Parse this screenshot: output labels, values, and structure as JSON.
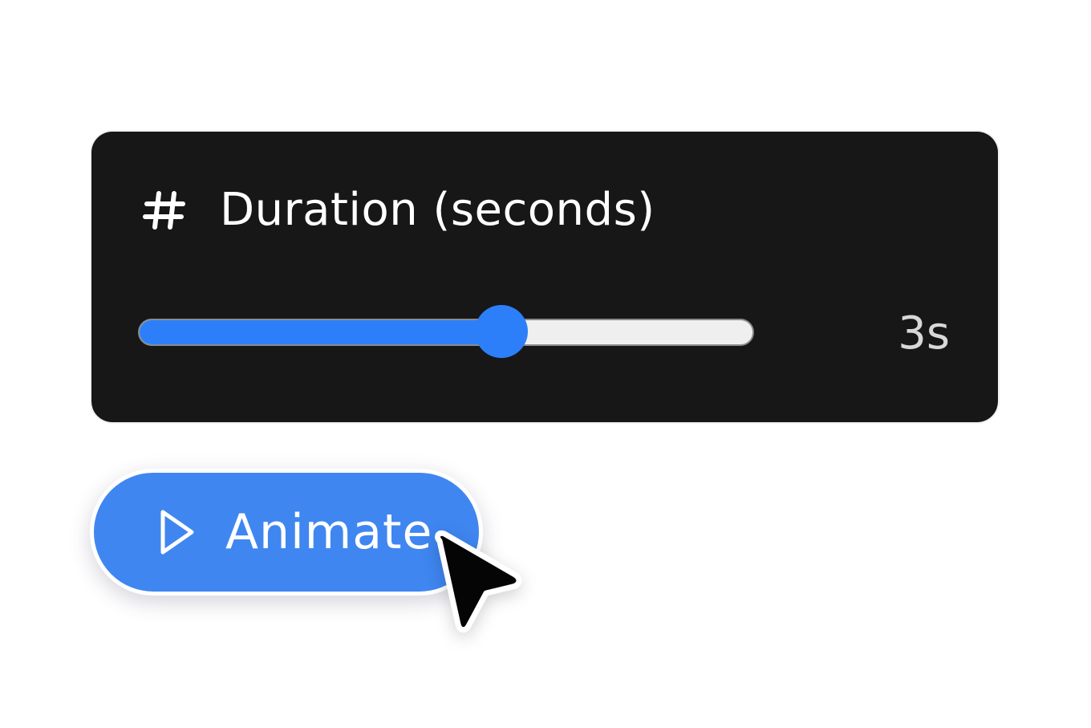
{
  "field": {
    "icon": "hash-icon",
    "label": "Duration (seconds)"
  },
  "slider": {
    "value_fraction": 0.59,
    "value_text": "3s"
  },
  "button": {
    "icon": "play-icon",
    "label": "Animate"
  },
  "cursor": {
    "icon": "mouse-pointer-icon"
  },
  "colors": {
    "panel_background": "#171717",
    "accent": "#2d7ff9",
    "button_background": "#3f86f1",
    "track": "#efefef",
    "value_text": "#d8d8d8"
  }
}
